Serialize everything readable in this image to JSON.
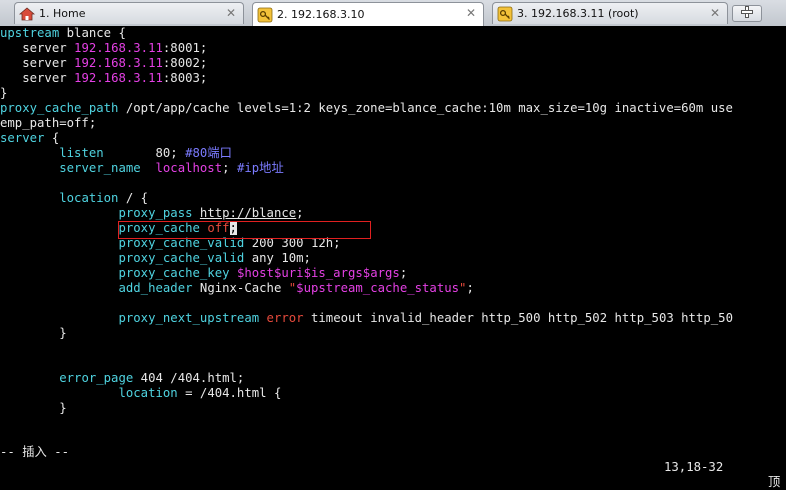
{
  "tabs": [
    {
      "label": "1. Home",
      "icon": "home-icon",
      "active": false
    },
    {
      "label": "2. 192.168.3.10",
      "icon": "key-icon",
      "active": true
    },
    {
      "label": "3. 192.168.3.11 (root)",
      "icon": "key-icon",
      "active": false
    }
  ],
  "new_tab_icon": "plus-icon",
  "code": {
    "l1": {
      "a": "upstream",
      "b": " blance {"
    },
    "l2": {
      "a": "   server ",
      "b": "192.168.3.11",
      "c": ":8001;"
    },
    "l3": {
      "a": "   server ",
      "b": "192.168.3.11",
      "c": ":8002;"
    },
    "l4": {
      "a": "   server ",
      "b": "192.168.3.11",
      "c": ":8003;"
    },
    "l5": {
      "a": "}"
    },
    "l6": {
      "a": "proxy_cache_path",
      "b": " /opt/app/cache levels=1:2 keys_zone=blance_cache:10m max_size=10g inactive=60m use"
    },
    "l7": {
      "a": "emp_path=off;"
    },
    "l8": {
      "a": "server",
      "b": " {"
    },
    "l9": {
      "a": "        ",
      "b": "listen",
      "c": "       80; ",
      "d": "#80端口"
    },
    "l10": {
      "a": "        ",
      "b": "server_name",
      "c": "  ",
      "d": "localhost",
      "e": "; ",
      "f": "#ip地址"
    },
    "l11": {
      "a": ""
    },
    "l12": {
      "a": "        ",
      "b": "location",
      "c": " / {"
    },
    "l13": {
      "a": "                ",
      "b": "proxy_pass",
      "c": " ",
      "d": "http://blance",
      "e": ";"
    },
    "l14": {
      "a": "                ",
      "b": "proxy_cache",
      "c": " ",
      "d": "off",
      "e": ";"
    },
    "l15": {
      "a": "                ",
      "b": "proxy_cache_valid",
      "c": " 200 300 12h;"
    },
    "l16": {
      "a": "                ",
      "b": "proxy_cache_valid",
      "c": " any 10m;"
    },
    "l17": {
      "a": "                ",
      "b": "proxy_cache_key",
      "c": " ",
      "d": "$host$uri$is_args$args",
      "e": ";"
    },
    "l18": {
      "a": "                ",
      "b": "add_header",
      "c": " Nginx-Cache ",
      "d": "\"",
      "e": "$upstream_cache_status",
      "f": "\"",
      "g": ";"
    },
    "l19": {
      "a": ""
    },
    "l20": {
      "a": "                ",
      "b": "proxy_next_upstream",
      "c": " ",
      "d": "error",
      "e": " timeout invalid_header http_500 http_502 http_503 http_50"
    },
    "l21": {
      "a": "        }"
    },
    "l22": {
      "a": ""
    },
    "l23": {
      "a": ""
    },
    "l24": {
      "a": "        ",
      "b": "error_page",
      "c": " 404 /404.html;"
    },
    "l25": {
      "a": "                ",
      "b": "location",
      "c": " = /404.html {"
    },
    "l26": {
      "a": "        }"
    }
  },
  "status": {
    "mode": "-- 插入 --",
    "position": "13,18-32",
    "scroll": "顶"
  },
  "colors": {
    "keyword": "#4fd3e0",
    "ip": "#e440e4",
    "string": "#7b7bff",
    "value": "#e64a3c",
    "comment": "#4fc34f",
    "highlight_box": "#e02020"
  }
}
